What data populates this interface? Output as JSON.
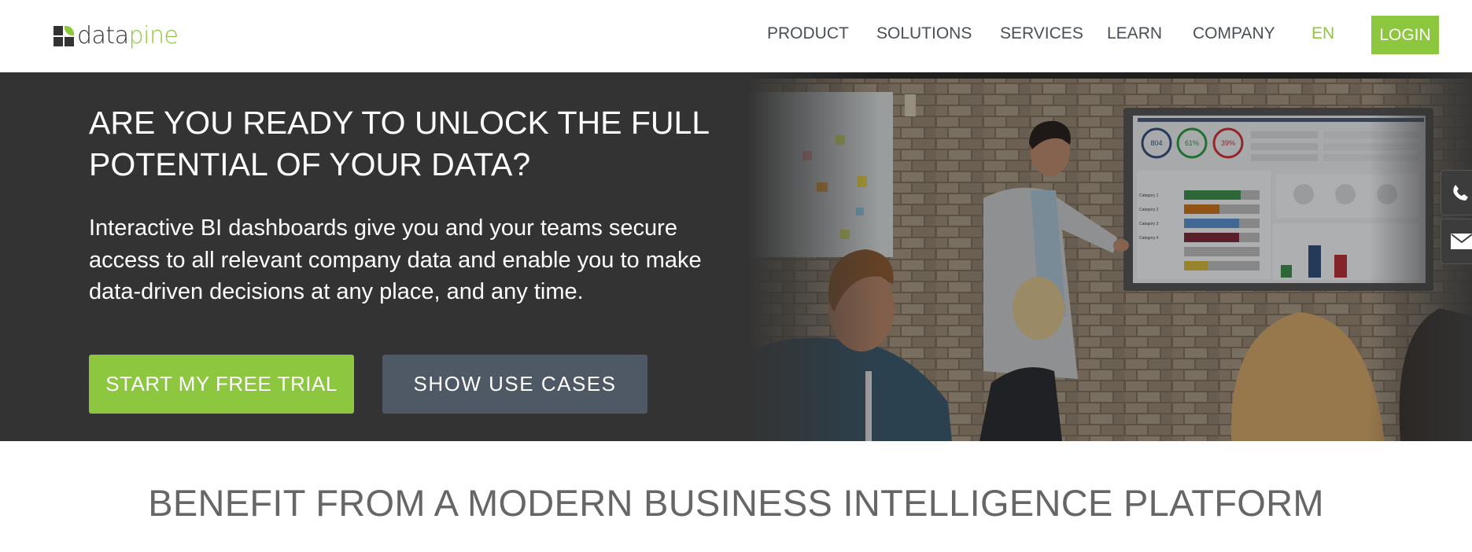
{
  "header": {
    "logo": {
      "part1": "data",
      "part2": "pine"
    },
    "nav": [
      "PRODUCT",
      "SOLUTIONS",
      "SERVICES",
      "LEARN",
      "COMPANY"
    ],
    "language": "EN",
    "login_label": "LOGIN"
  },
  "hero": {
    "title_line1": "ARE YOU READY TO UNLOCK THE FULL",
    "title_line2": "POTENTIAL OF YOUR DATA?",
    "text_line1": "Interactive BI dashboards give you and your teams secure",
    "text_line2": "access to all relevant company data and enable you to make",
    "text_line3": "data-driven decisions at any place, and any time.",
    "primary_button": "START MY FREE TRIAL",
    "secondary_button": "SHOW USE CASES",
    "screen_kpis": [
      "804",
      "61%",
      "39%"
    ],
    "screen_categories": [
      "Category 1",
      "Category 2",
      "Category 3",
      "Category 4"
    ]
  },
  "contact": {
    "icons": [
      "phone-icon",
      "mail-icon"
    ]
  },
  "section": {
    "title": "BENEFIT FROM A MODERN BUSINESS INTELLIGENCE PLATFORM"
  },
  "colors": {
    "brand_green": "#8dc63f",
    "hero_bg": "#333333",
    "secondary_button": "#4f5865",
    "text_gray": "#666666"
  }
}
